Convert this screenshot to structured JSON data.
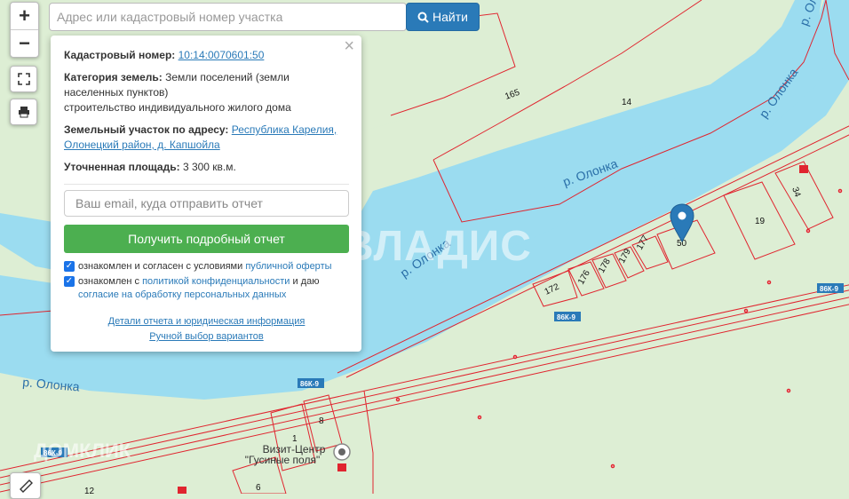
{
  "search": {
    "placeholder": "Адрес или кадастровый номер участка",
    "button_label": "Найти"
  },
  "zoom": {
    "in_label": "+",
    "out_label": "−"
  },
  "popup": {
    "close_label": "×",
    "cadastral_label": "Кадастровый номер:",
    "cadastral_value": "10:14:0070601:50",
    "category_label": "Категория земель:",
    "category_value": "Земли поселений (земли населенных пунктов)",
    "category_use": "строительство индивидуального жилого дома",
    "address_label": "Земельный участок по адресу:",
    "address_value": "Республика Карелия, Олонецкий район, д. Капшойла",
    "area_label": "Уточненная площадь:",
    "area_value": "3 300 кв.м.",
    "email_placeholder": "Ваш email, куда отправить отчет",
    "report_button": "Получить подробный отчет",
    "consent1_text": "ознакомлен и согласен с условиями",
    "consent1_link": "публичной оферты",
    "consent2_text": "ознакомлен с",
    "consent2_link1": "политикой конфиденциальности",
    "consent2_mid": "и даю",
    "consent2_link2": "согласие на обработку персональных данных",
    "details_link": "Детали отчета и юридическая информация",
    "manual_link": "Ручной выбор вариантов"
  },
  "map": {
    "river_name": "р. Олонка",
    "road_code": "86К-9",
    "poi_name": "Визит-Центр",
    "poi_name2": "\"Гусиные поля\"",
    "parcel_numbers": [
      "165",
      "14",
      "34",
      "19",
      "177",
      "50",
      "179",
      "178",
      "176",
      "172",
      "8",
      "1",
      "6",
      "12"
    ],
    "watermark_main": "ВЛАДИС",
    "watermark_bottom": "ДОМКЛИК",
    "colors": {
      "water": "#9bdcf0",
      "land": "#ddeed4",
      "parcel_line": "#e0252f",
      "marker": "#2a7ab8"
    }
  }
}
